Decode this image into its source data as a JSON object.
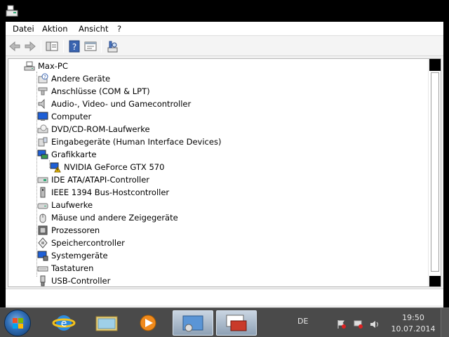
{
  "menubar": {
    "items": [
      {
        "label": "Datei"
      },
      {
        "label": "Aktion"
      },
      {
        "label": "Ansicht"
      },
      {
        "label": "?"
      }
    ]
  },
  "toolbar": {
    "buttons": [
      "back-arrow-icon",
      "forward-arrow-icon",
      "show-hide-console-tree-icon",
      "help-icon",
      "properties-icon",
      "scan-hardware-icon"
    ]
  },
  "tree": {
    "root": {
      "label": "Max-PC",
      "icon": "computer-icon"
    },
    "categories": [
      {
        "label": "Andere Geräte",
        "icon": "unknown-device-icon"
      },
      {
        "label": "Anschlüsse (COM & LPT)",
        "icon": "port-icon"
      },
      {
        "label": "Audio-, Video- und Gamecontroller",
        "icon": "speaker-icon"
      },
      {
        "label": "Computer",
        "icon": "monitor-icon"
      },
      {
        "label": "DVD/CD-ROM-Laufwerke",
        "icon": "optical-drive-icon"
      },
      {
        "label": "Eingabegeräte (Human Interface Devices)",
        "icon": "hid-icon"
      },
      {
        "label": "Grafikkarte",
        "icon": "display-adapter-icon"
      },
      {
        "label": "NVIDIA GeForce GTX 570",
        "icon": "display-adapter-warning-icon",
        "child": true
      },
      {
        "label": "IDE ATA/ATAPI-Controller",
        "icon": "ide-controller-icon"
      },
      {
        "label": "IEEE 1394 Bus-Hostcontroller",
        "icon": "firewire-icon"
      },
      {
        "label": "Laufwerke",
        "icon": "disk-drive-icon"
      },
      {
        "label": "Mäuse und andere Zeigegeräte",
        "icon": "mouse-icon"
      },
      {
        "label": "Prozessoren",
        "icon": "processor-icon"
      },
      {
        "label": "Speichercontroller",
        "icon": "storage-controller-icon"
      },
      {
        "label": "Systemgeräte",
        "icon": "system-device-icon"
      },
      {
        "label": "Tastaturen",
        "icon": "keyboard-icon"
      },
      {
        "label": "USB-Controller",
        "icon": "usb-icon"
      }
    ]
  },
  "taskbar": {
    "pinned": [
      "internet-explorer-icon",
      "explorer-icon",
      "media-player-icon",
      "control-panel-icon",
      "device-manager-icon"
    ],
    "language": "DE",
    "time": "19:50",
    "date": "10.07.2014"
  },
  "colors": {
    "tree_background": "#ffffff",
    "window_frame": "#000000",
    "taskbar": "#4a4a4a"
  }
}
